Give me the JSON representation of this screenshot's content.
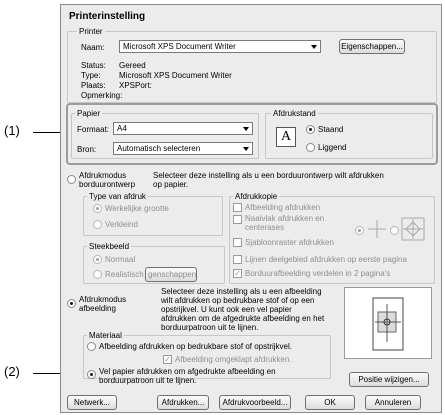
{
  "window": {
    "title": "Printerinstelling"
  },
  "printer": {
    "group_label": "Printer",
    "name_label": "Naam:",
    "name_value": "Microsoft XPS Document Writer",
    "properties_button": "Eigenschappen...",
    "status_label": "Status:",
    "status_value": "Gereed",
    "type_label": "Type:",
    "type_value": "Microsoft XPS Document Writer",
    "place_label": "Plaats:",
    "place_value": "XPSPort:",
    "comment_label": "Opmerking:"
  },
  "paper": {
    "group_label": "Papier",
    "format_label": "Formaat:",
    "format_value": "A4",
    "source_label": "Bron:",
    "source_value": "Automatisch selecteren"
  },
  "orientation": {
    "group_label": "Afdrukstand",
    "portrait": "Staand",
    "landscape": "Liggend",
    "glyph": "A"
  },
  "mode1": {
    "radio_label_1": "Afdrukmodus",
    "radio_label_2": "borduurontwerp",
    "desc_1": "Selecteer deze instelling als u een borduurontwerp wilt afdrukken",
    "desc_2": "op papier.",
    "type_group": "Type van afdruk",
    "actual_size": "Werkelijke grootte",
    "reduced": "Verkleind",
    "stitch_group": "Steekbeeld",
    "normal": "Normaal",
    "realistic": "Realistisch",
    "props_partial": "genschappen",
    "copy_group": "Afdrukkopie",
    "print_image": "Afbeelding afdrukken",
    "seam_1": "Naaivlak afdrukken en",
    "seam_2": "centerases",
    "template": "Sjabloonraster afdrukken",
    "lines": "Lijnen deelgebied afdrukken op eerste pagina",
    "split": "Borduurafbeelding verdelen in 2 pagina's"
  },
  "mode2": {
    "radio_label_1": "Afdrukmodus",
    "radio_label_2": "afbeelding",
    "desc": [
      "Selecteer deze instelling als u een afbeelding",
      "wilt afdrukken op bedrukbare stof of op een",
      "opstrijkvel. U kunt ook een vel papier",
      "afdrukken om de afgedrukte afbeelding en het",
      "borduurpatroon uit te lijnen."
    ],
    "material_group": "Materiaal",
    "fabric": "Afbeelding afdrukken op bedrukbare stof of opstrijkvel.",
    "mirror": "Afbeelding omgeklapt afdrukken.",
    "paper_1": "Vel papier afdrukken om afgedrukte afbeelding en",
    "paper_2": "borduurpatroon uit te lijnen.",
    "position_button": "Positie wijzigen..."
  },
  "footer": {
    "network": "Netwerk...",
    "print": "Afdrukken...",
    "preview": "Afdrukvoorbeeld...",
    "ok": "OK",
    "cancel": "Annuleren"
  },
  "callouts": {
    "c1": "(1)",
    "c2": "(2)"
  }
}
